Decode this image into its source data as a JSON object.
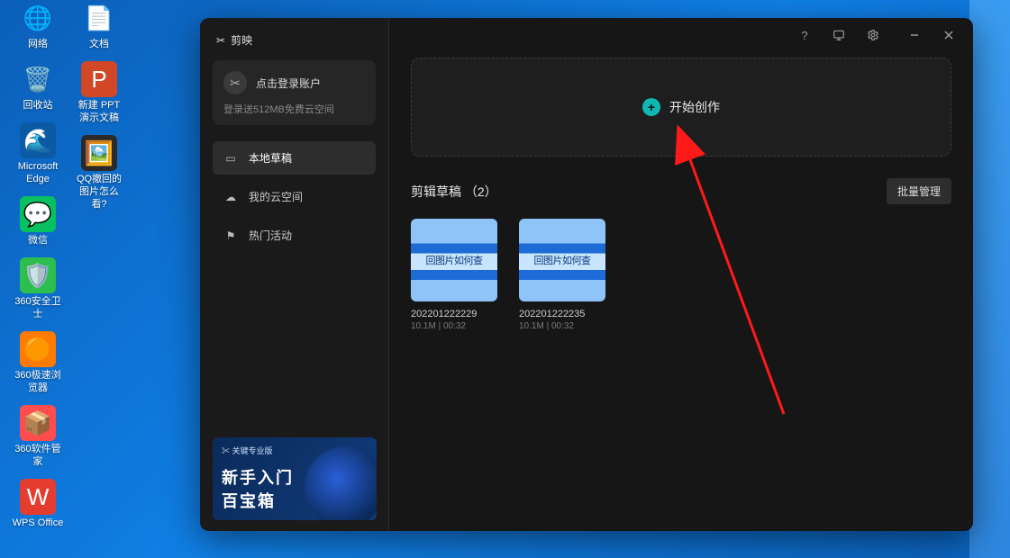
{
  "desktop": {
    "col1": [
      {
        "label": "网络",
        "glyph": "🌐",
        "bg": "transparent"
      },
      {
        "label": "回收站",
        "glyph": "🗑️",
        "bg": "transparent"
      },
      {
        "label": "Microsoft Edge",
        "glyph": "🌊",
        "bg": "#0c59a4"
      },
      {
        "label": "微信",
        "glyph": "💬",
        "bg": "#07c160"
      },
      {
        "label": "360安全卫士",
        "glyph": "🛡️",
        "bg": "#2dbf4e"
      },
      {
        "label": "360极速浏览器",
        "glyph": "🟠",
        "bg": "#ff7a00"
      },
      {
        "label": "360软件管家",
        "glyph": "📦",
        "bg": "#ff4d4f"
      },
      {
        "label": "WPS Office",
        "glyph": "W",
        "bg": "#e43d30"
      }
    ],
    "col2": [
      {
        "label": "文档",
        "glyph": "📄",
        "bg": "transparent"
      },
      {
        "label": "新建 PPT 演示文稿",
        "glyph": "P",
        "bg": "#d24726"
      },
      {
        "label": "QQ撤回的图片怎么看?",
        "glyph": "🖼️",
        "bg": "#2a2a2a"
      }
    ]
  },
  "app": {
    "title": "剪映",
    "login": {
      "button": "点击登录账户",
      "sub": "登录送512MB免费云空间"
    },
    "nav": [
      {
        "label": "本地草稿",
        "active": true
      },
      {
        "label": "我的云空间",
        "active": false
      },
      {
        "label": "热门活动",
        "active": false
      }
    ],
    "promo": {
      "tag": "✂ 关键专业版",
      "line1": "新手入门",
      "line2": "百宝箱"
    },
    "create_label": "开始创作",
    "drafts_title_prefix": "剪辑草稿",
    "drafts_count": "2",
    "batch_label": "批量管理",
    "drafts": [
      {
        "thumb_text": "回图片如何查",
        "name": "202201222229",
        "meta": "10.1M | 00:32"
      },
      {
        "thumb_text": "回图片如何查",
        "name": "202201222235",
        "meta": "10.1M | 00:32"
      }
    ]
  }
}
